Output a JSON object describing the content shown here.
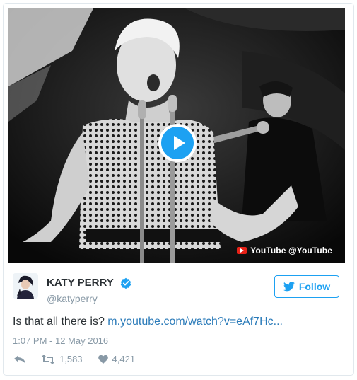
{
  "video": {
    "badge_text": "YouTube @YouTube",
    "play_color": "#1da1f2"
  },
  "author": {
    "name": "KATY PERRY",
    "handle": "@katyperry",
    "verified": true
  },
  "follow_label": "Follow",
  "tweet": {
    "text": "Is that all there is?",
    "link_text": "m.youtube.com/watch?v=eAf7Hc..."
  },
  "timestamp": "1:07 PM - 12 May 2016",
  "stats": {
    "retweets": "1,583",
    "likes": "4,421"
  },
  "icons": [
    "play-icon",
    "youtube-icon",
    "verified-icon",
    "twitter-bird-icon",
    "reply-icon",
    "retweet-icon",
    "heart-icon"
  ],
  "colors": {
    "accent": "#1da1f2",
    "link": "#2b7bb9",
    "muted": "#8899a6",
    "youtube_red": "#e62117"
  }
}
